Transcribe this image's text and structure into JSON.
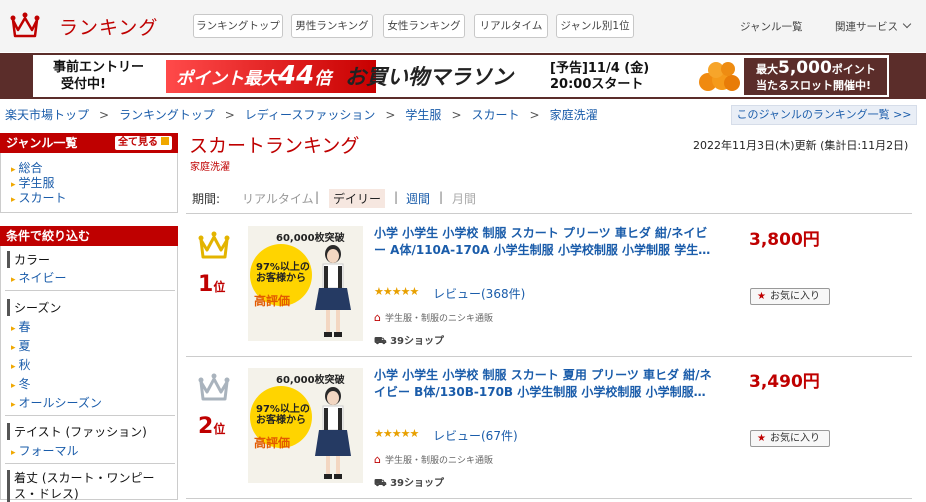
{
  "header": {
    "logo_text": "ランキング",
    "tabs": [
      "ランキングトップ",
      "男性ランキング",
      "女性ランキング",
      "リアルタイム",
      "ジャンル別1位"
    ],
    "genre_list": "ジャンル一覧",
    "related_services": "関連サービス"
  },
  "banner": {
    "pre_line1": "事前エントリー",
    "pre_line2": "受付中!",
    "point_prefix": "ポイント最大",
    "point_value": "44",
    "point_suffix": "倍",
    "title": "お買い物マラソン",
    "date_line1": "[予告]11/4 (金)",
    "date_line2": "20:00スタート",
    "right_line1_prefix": "最大",
    "right_line1_value": "5,000",
    "right_line1_suffix": "ポイント",
    "right_line2": "当たるスロット開催中!"
  },
  "breadcrumb": [
    "楽天市場トップ",
    "ランキングトップ",
    "レディースファッション",
    "学生服",
    "スカート",
    "家庭洗濯"
  ],
  "genre_ranking_link": "このジャンルのランキング一覧 >>",
  "sidebar": {
    "genre_title": "ジャンル一覧",
    "show_all": "全て見る",
    "genre_items": [
      "総合",
      "学生服",
      "スカート"
    ],
    "filter_title": "条件で絞り込む",
    "filters": [
      {
        "category": "カラー",
        "items": [
          "ネイビー"
        ]
      },
      {
        "category": "シーズン",
        "items": [
          "春",
          "夏",
          "秋",
          "冬",
          "オールシーズン"
        ]
      },
      {
        "category": "テイスト (ファッション)",
        "items": [
          "フォーマル"
        ]
      },
      {
        "category": "着丈 (スカート・ワンピース・ドレス)",
        "items": []
      }
    ]
  },
  "main": {
    "title": "スカートランキング",
    "subtitle": "家庭洗濯",
    "updated": "2022年11月3日(木)更新 (集計日:11月2日)",
    "period_label": "期間:",
    "periods": [
      "リアルタイム",
      "デイリー",
      "週間",
      "月間"
    ],
    "active_period": "デイリー"
  },
  "items": [
    {
      "rank": "1",
      "rank_suffix": "位",
      "crown": "gold-crown-icon",
      "title": "小学 小学生 小学校 制服 スカート プリーツ 車ヒダ 紺/ネイビー A体/110A-170A 小学生制服 小学校制服 小学制服 学生…",
      "stars": "★★★★★",
      "review": "レビュー(368件)",
      "shop": "学生服・制服のニシキ通販",
      "shipping": "39ショップ",
      "price": "3,800円",
      "fav": "お気に入り",
      "thumb_top": "60,000枚突破",
      "thumb_pct": "97%以上の",
      "thumb_pct2": "お客様から",
      "thumb_hyoka": "高評価"
    },
    {
      "rank": "2",
      "rank_suffix": "位",
      "crown": "silver-crown-icon",
      "title": "小学 小学生 小学校 制服 スカート 夏用 プリーツ 車ヒダ 紺/ネイビー B体/130B-170B 小学生制服 小学校制服 小学制服…",
      "stars": "★★★★★",
      "review": "レビュー(67件)",
      "shop": "学生服・制服のニシキ通販",
      "shipping": "39ショップ",
      "price": "3,490円",
      "fav": "お気に入り",
      "thumb_top": "60,000枚突破",
      "thumb_pct": "97%以上の",
      "thumb_pct2": "お客様から",
      "thumb_hyoka": "高評価"
    }
  ]
}
